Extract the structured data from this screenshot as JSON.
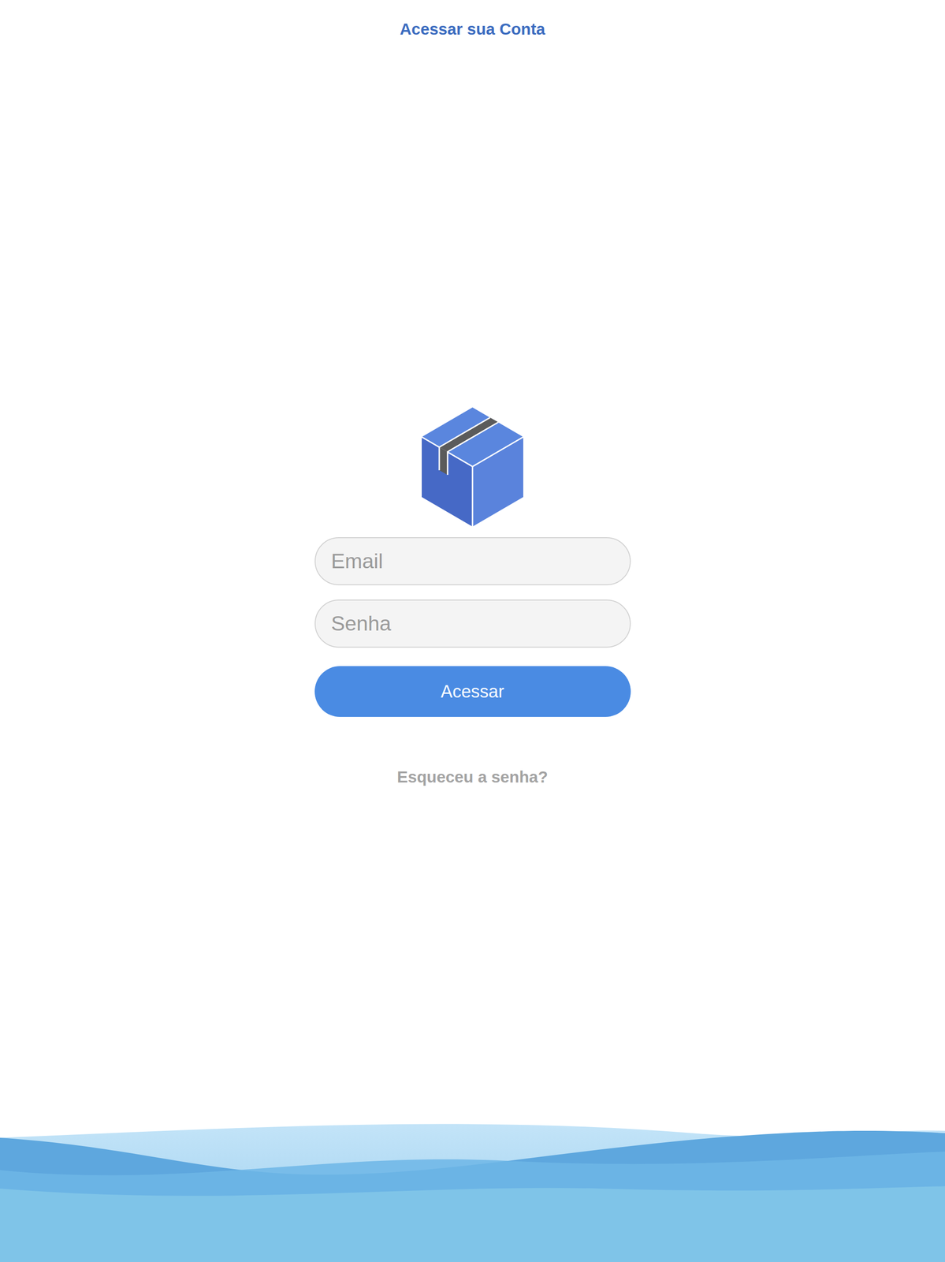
{
  "window": {
    "title": "Acessar sua Conta"
  },
  "form": {
    "email_placeholder": "Email",
    "password_placeholder": "Senha",
    "submit": "Acessar",
    "forgot": "Esqueceu a senha?"
  }
}
